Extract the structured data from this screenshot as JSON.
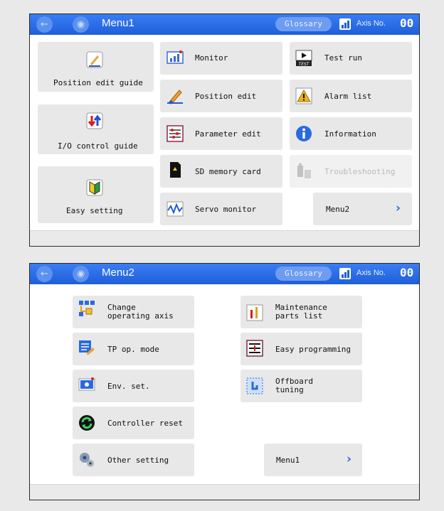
{
  "screen1": {
    "header": {
      "title": "Menu1",
      "glossary": "Glossary",
      "axis_label": "Axis No.",
      "axis_number": "00"
    },
    "guides": [
      {
        "label": "Position edit guide",
        "icon": "pencil-guide-icon"
      },
      {
        "label": "I/O control guide",
        "icon": "io-arrows-icon"
      },
      {
        "label": "Easy setting",
        "icon": "beginner-mark-icon"
      }
    ],
    "col2": [
      {
        "label": "Monitor",
        "icon": "monitor-chart-icon"
      },
      {
        "label": "Position edit",
        "icon": "pencil-icon"
      },
      {
        "label": "Parameter edit",
        "icon": "sliders-icon"
      },
      {
        "label": "SD memory card",
        "icon": "sd-card-icon"
      },
      {
        "label": "Servo monitor",
        "icon": "waveform-icon"
      }
    ],
    "col3": [
      {
        "label": "Test run",
        "icon": "test-run-icon"
      },
      {
        "label": "Alarm list",
        "icon": "warning-icon"
      },
      {
        "label": "Information",
        "icon": "info-icon"
      },
      {
        "label": "Troubleshooting",
        "icon": "troubleshooting-icon"
      }
    ],
    "next": {
      "label": "Menu2"
    }
  },
  "screen2": {
    "header": {
      "title": "Menu2",
      "glossary": "Glossary",
      "axis_label": "Axis No.",
      "axis_number": "00"
    },
    "left": [
      {
        "label": "Change\noperating axis",
        "icon": "axis-change-icon"
      },
      {
        "label": "TP op. mode",
        "icon": "tp-mode-icon"
      },
      {
        "label": "Env. set.",
        "icon": "env-monitor-icon"
      },
      {
        "label": "Controller reset",
        "icon": "reset-icon"
      },
      {
        "label": "Other setting",
        "icon": "gears-icon"
      }
    ],
    "right": [
      {
        "label": "Maintenance\nparts list",
        "icon": "maintenance-icon"
      },
      {
        "label": "Easy programming",
        "icon": "program-icon"
      },
      {
        "label": "Offboard\ntuning",
        "icon": "tuning-icon"
      }
    ],
    "next": {
      "label": "Menu1"
    }
  },
  "colors": {
    "header_blue": "#1f5fd8",
    "button_gray": "#e8e8e8",
    "accent_blue": "#2f6fe0"
  }
}
